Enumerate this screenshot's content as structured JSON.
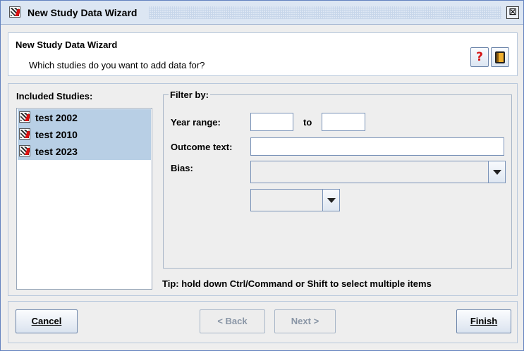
{
  "window": {
    "title": "New Study Data Wizard",
    "close_glyph": "⊠"
  },
  "header": {
    "title": "New Study Data Wizard",
    "subtitle": "Which studies do you want to add data for?",
    "help_glyph": "?",
    "icons": [
      "help-icon",
      "book-icon"
    ]
  },
  "studies": {
    "label": "Included Studies:",
    "items": [
      {
        "label": "test 2002"
      },
      {
        "label": "test 2010"
      },
      {
        "label": "test 2023"
      }
    ],
    "selected_color": "#b8cfe5"
  },
  "filter": {
    "legend": "Filter by:",
    "year_range_label": "Year range:",
    "year_from_value": "",
    "to_label": "to",
    "year_to_value": "",
    "outcome_label": "Outcome text:",
    "outcome_value": "",
    "bias_label": "Bias:",
    "bias_selected": "",
    "bias_sub_selected": ""
  },
  "tip": "Tip: hold down Ctrl/Command or Shift to select multiple items",
  "footer": {
    "cancel_label": "Cancel",
    "back_label": "< Back",
    "next_label": "Next >",
    "finish_label": "Finish"
  }
}
